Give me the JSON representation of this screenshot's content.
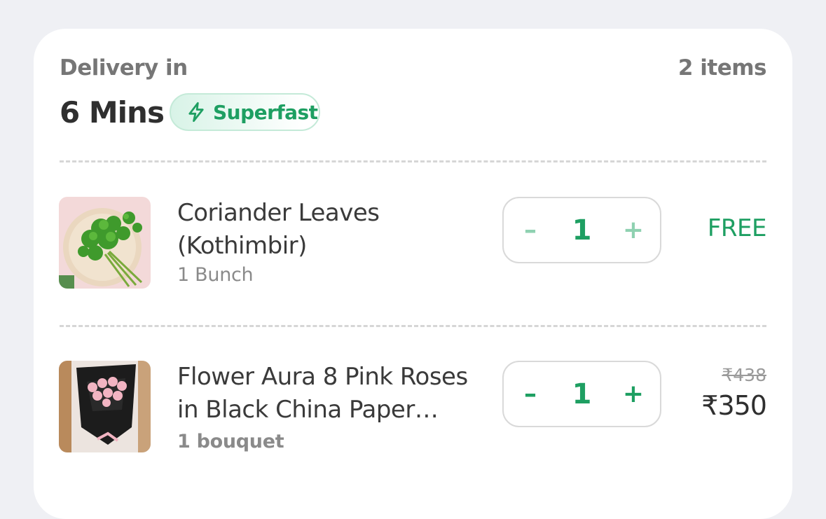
{
  "delivery": {
    "label": "Delivery in",
    "eta": "6 Mins",
    "badge": "Superfast",
    "items_count": "2 items"
  },
  "items": [
    {
      "name_line1": "Coriander Leaves",
      "name_line2": "(Kothimbir)",
      "unit": "1 Bunch",
      "qty": "1",
      "minus": "–",
      "plus": "+",
      "price": "FREE"
    },
    {
      "name_line1": "Flower Aura 8 Pink Roses",
      "name_line2": "in Black China Paper…",
      "unit": "1 bouquet",
      "qty": "1",
      "minus": "–",
      "plus": "+",
      "original_price": "₹438",
      "price": "₹350"
    }
  ],
  "colors": {
    "accent_green": "#1e9f62",
    "disabled_green": "#8fd1b1",
    "page_bg": "#eff0f4"
  },
  "icons": [
    "lightning-icon",
    "minus-icon",
    "plus-icon"
  ]
}
